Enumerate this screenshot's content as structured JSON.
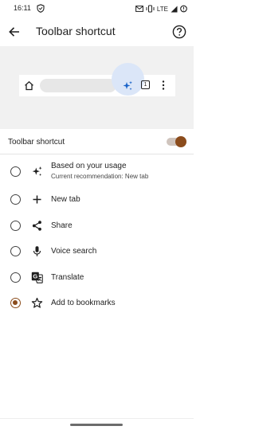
{
  "status_bar": {
    "time": "16:11",
    "network": "LTE"
  },
  "header": {
    "title": "Toolbar shortcut",
    "back_icon": "arrow-back-icon",
    "help_icon": "help-circle-icon"
  },
  "preview": {
    "tab_count": "1",
    "highlight_color": "#dbe6f8",
    "shortcut_icon": "sparkle-icon"
  },
  "toggle_row": {
    "label": "Toolbar shortcut",
    "enabled": true,
    "accent_color": "#8b4c1c"
  },
  "options": [
    {
      "label": "Based on your usage",
      "sublabel": "Current recommendation:  New tab",
      "icon": "sparkle-icon",
      "selected": false
    },
    {
      "label": "New tab",
      "icon": "plus-icon",
      "selected": false
    },
    {
      "label": "Share",
      "icon": "share-icon",
      "selected": false
    },
    {
      "label": "Voice search",
      "icon": "mic-icon",
      "selected": false
    },
    {
      "label": "Translate",
      "icon": "translate-icon",
      "selected": false
    },
    {
      "label": "Add to bookmarks",
      "icon": "star-outline-icon",
      "selected": true
    }
  ]
}
